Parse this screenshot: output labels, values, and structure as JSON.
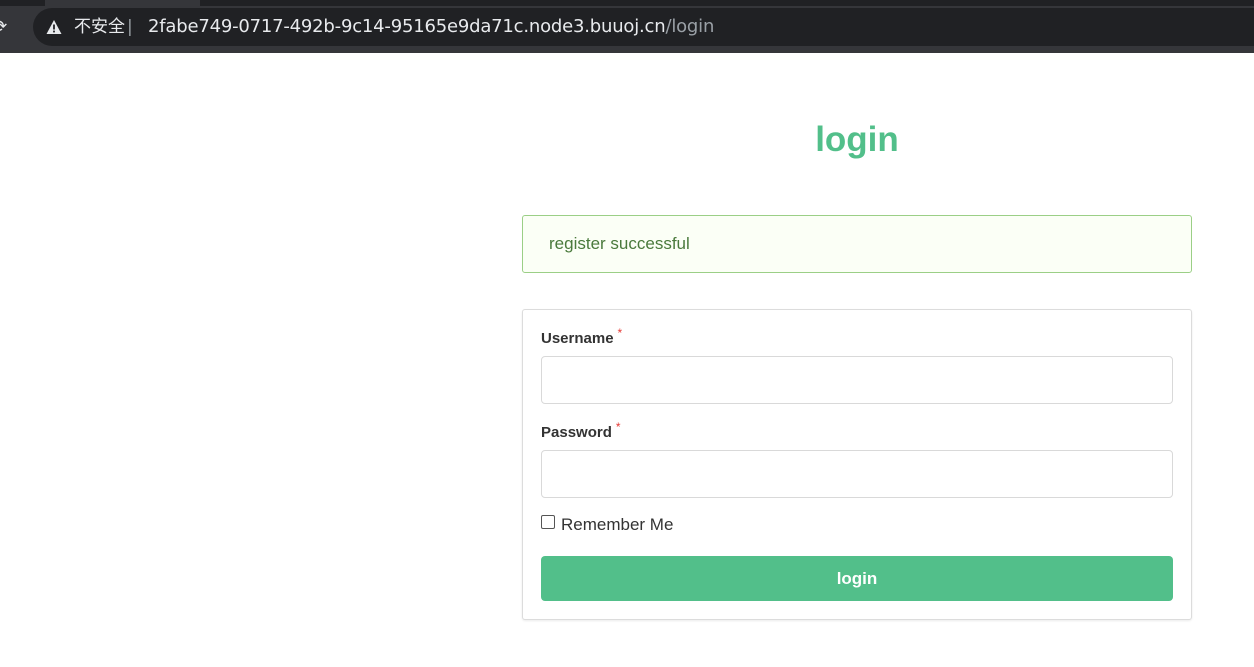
{
  "browser": {
    "security_label": "不安全",
    "separator": "|",
    "url_host": "2fabe749-0717-492b-9c14-95165e9da71c.node3.buuoj.cn",
    "url_path": "/login",
    "reload_icon": "reload-icon",
    "warning_icon": "warning-triangle-icon"
  },
  "page": {
    "title": "login"
  },
  "alert": {
    "message": "register successful"
  },
  "form": {
    "username_label": "Username",
    "password_label": "Password",
    "required_marker": "*",
    "username_value": "",
    "password_value": "",
    "remember_label": "Remember Me",
    "remember_checked": false,
    "submit_label": "login"
  },
  "colors": {
    "accent": "#52bf8a",
    "alert_border": "#9bcf86",
    "alert_bg": "#fbfff6",
    "required": "#e53935"
  }
}
